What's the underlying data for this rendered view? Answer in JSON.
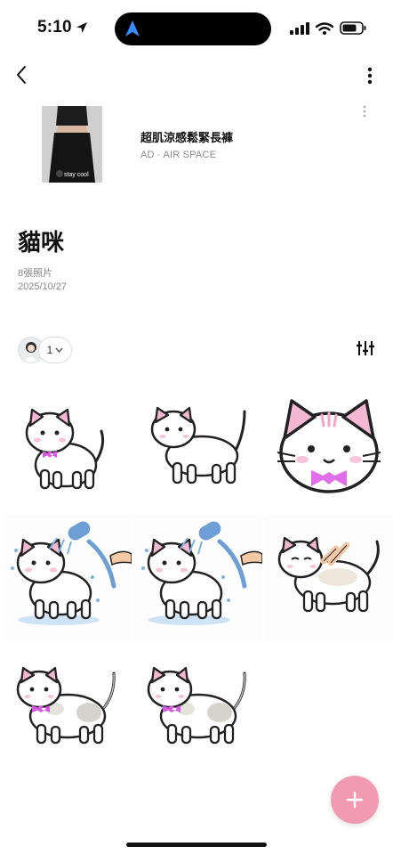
{
  "status_bar": {
    "time": "5:10"
  },
  "ad": {
    "title": "超肌涼感鬆緊長褲",
    "subtitle": "AD · AIR SPACE",
    "thumb_text": "stay cool"
  },
  "board": {
    "title": "貓咪",
    "pin_count": "8張照片",
    "date": "2025/10/27"
  },
  "collaborators": {
    "count": "1"
  },
  "pins": [
    {
      "scene": "cat-standing-bow"
    },
    {
      "scene": "cat-walking"
    },
    {
      "scene": "cat-face-bow"
    },
    {
      "scene": "cat-shower"
    },
    {
      "scene": "cat-shower"
    },
    {
      "scene": "cat-brushing"
    },
    {
      "scene": "cat-patched-bow"
    },
    {
      "scene": "cat-patched-bow"
    }
  ],
  "colors": {
    "accent": "#f39ab3",
    "bow": "#d45be0",
    "water": "#7fb3e0"
  }
}
